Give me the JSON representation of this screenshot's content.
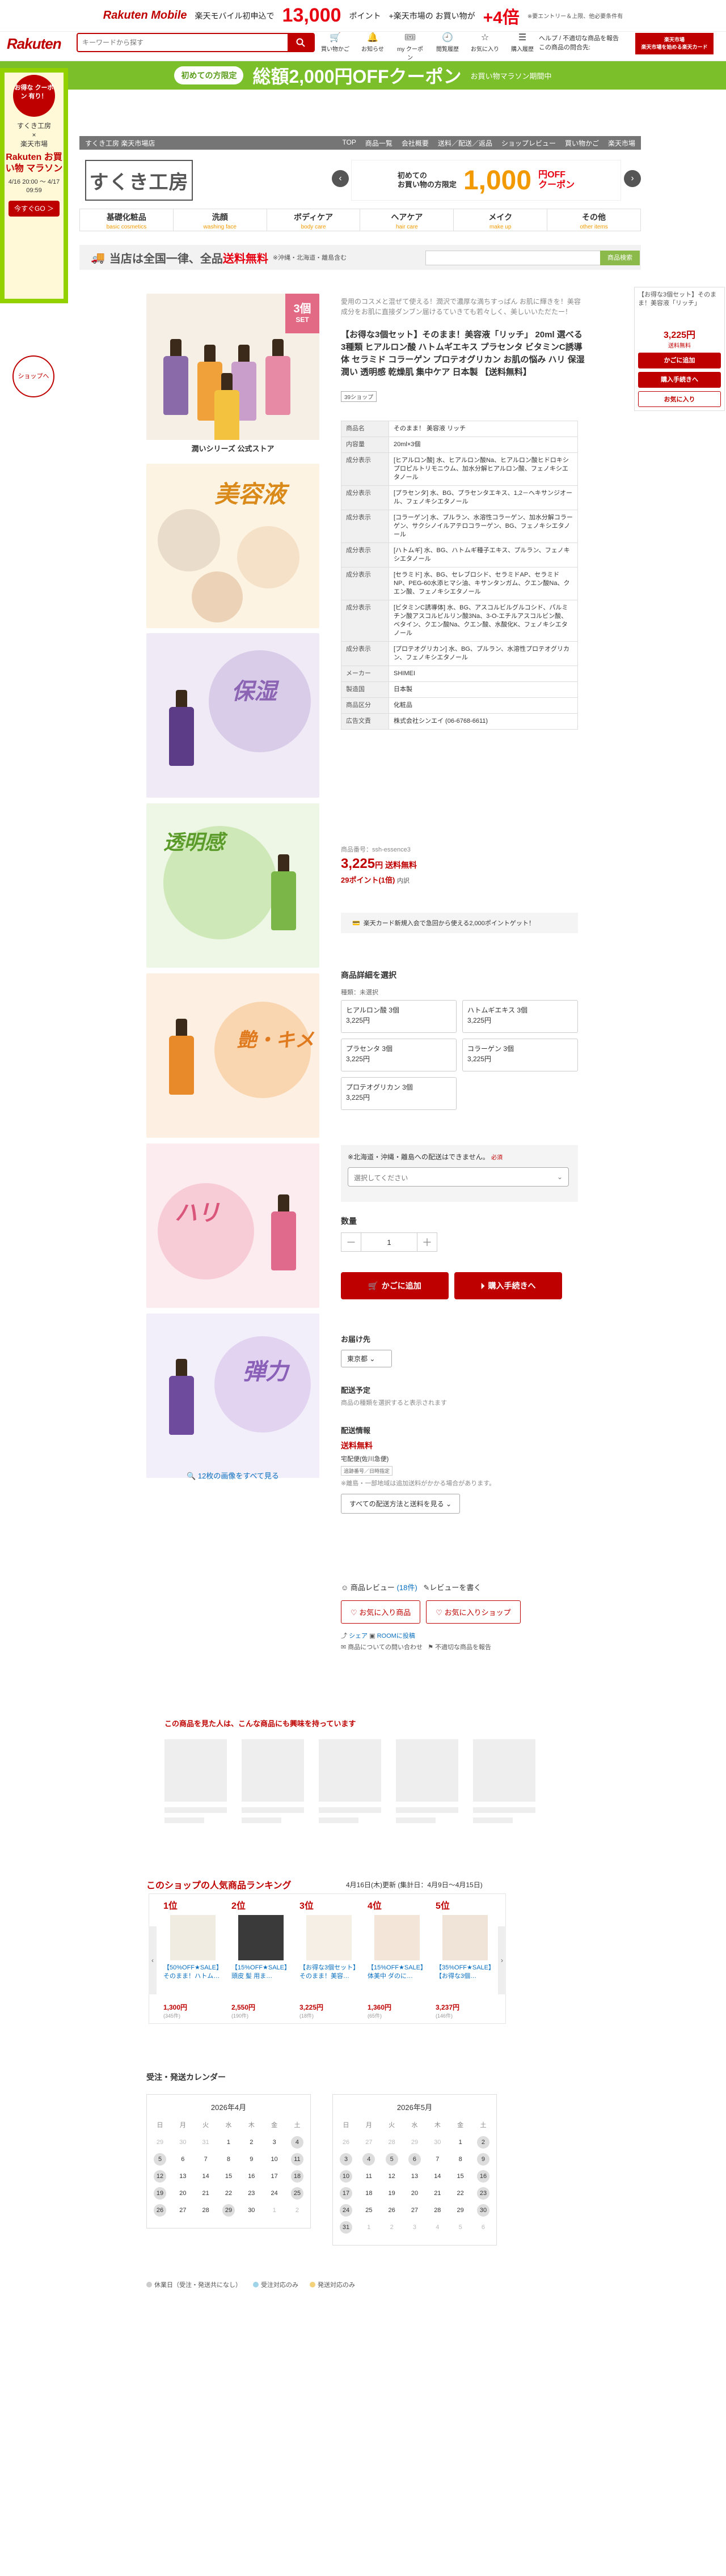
{
  "promo": {
    "brand": "Rakuten Mobile",
    "text1": "楽天モバイル初申込で",
    "big": "13,000",
    "pt": "ポイント",
    "plus_text": "+楽天市場の お買い物が",
    "plus": "+4倍",
    "note": "※要エントリー＆上限、他必要条件有"
  },
  "header": {
    "logo": "Rakuten",
    "search_placeholder": "キーワードから探す",
    "icons": [
      {
        "label": "買い物かご",
        "icon": "cart-icon",
        "glyph": "🛒"
      },
      {
        "label": "お知らせ",
        "icon": "bell-icon",
        "glyph": "🔔"
      },
      {
        "label": "my クーポン",
        "icon": "coupon-icon",
        "glyph": "🎟"
      },
      {
        "label": "閲覧履歴",
        "icon": "history-icon",
        "glyph": "🕘"
      },
      {
        "label": "お気に入り",
        "icon": "star-icon",
        "glyph": "☆"
      },
      {
        "label": "購入履歴",
        "icon": "list-icon",
        "glyph": "☰"
      }
    ],
    "help1": "ヘルプ / 不適切な商品を報告",
    "help2": "この商品の問合先:",
    "ad_line1": "楽天市場",
    "ad_line2": "楽天市場を始める楽天カード"
  },
  "green_banner": {
    "pill": "初めての方限定",
    "big": "総額2,000円OFFクーポン",
    "small": "お買い物マラソン期間中"
  },
  "side_campaign": {
    "coupon": "お得な クーポン 有り！",
    "t1": "すくき工房",
    "t2": "×",
    "t3": "楽天市場",
    "title": "Rakuten お買い物 マラソン",
    "dates": "4/16 20:00 ～ 4/17 09:59",
    "button": "今すぐGO ＞"
  },
  "float_shop": "ショップへ",
  "shopnav": {
    "name": "すくき工房 楽天市場店",
    "links": [
      "TOP",
      "商品一覧",
      "会社概要",
      "送料／配送／返品",
      "ショップレビュー",
      "買い物かご",
      "楽天市場"
    ]
  },
  "shop_logo": "すくき工房",
  "coupon_banner": {
    "line1": "初めての",
    "line2": "お買い物の方限定",
    "amount": "1,000",
    "unit": "円OFF",
    "unit2": "クーポン"
  },
  "categories": [
    {
      "ja": "基礎化粧品",
      "en": "basic cosmetics"
    },
    {
      "ja": "洗顔",
      "en": "washing face"
    },
    {
      "ja": "ボディケア",
      "en": "body care"
    },
    {
      "ja": "ヘアケア",
      "en": "hair care"
    },
    {
      "ja": "メイク",
      "en": "make up"
    },
    {
      "ja": "その他",
      "en": "other items"
    }
  ],
  "ship": {
    "pre": "当店は全国一律、全品",
    "red": "送料無料",
    "note": "※沖縄・北海道・離島含む",
    "search_btn": "商品検索"
  },
  "images": {
    "main_badge": "3個",
    "main_badge2": "SET",
    "store_label": "潤いシリーズ 公式ストア",
    "img2": "美容液",
    "img3": "保湿",
    "img4": "透明感",
    "img5": "艶・キメ",
    "img6": "ハリ",
    "img7": "弾力",
    "more": "12枚の画像をすべて見る"
  },
  "description": "愛用のコスメと混ぜて使える！潤沢で濃厚な満ちすっぱん お肌に輝きを！美容成分をお肌に直接ダンブン届けるていきても若々しく、美しいいただたー！",
  "title": "【お得な3個セット】そのまま！美容液「リッチ」 20ml 選べる3種類 ヒアルロン酸 ハトムギエキス プラセンタ ビタミンC誘導体 セラミド コラーゲン プロテオグリカン お肌の悩み ハリ 保湿 潤い 透明感 乾燥肌 集中ケア 日本製 【送料無料】",
  "shop_tag": "39ショップ",
  "spec": [
    {
      "k": "商品名",
      "v": "そのまま！ 美容液 リッチ"
    },
    {
      "k": "内容量",
      "v": "20ml×3個"
    },
    {
      "k": "成分表示",
      "v": "[ヒアルロン酸] 水、ヒアルロン酸Na、ヒアルロン酸ヒドロキシプロピルトリモニウム、加水分解ヒアルロン酸、フェノキシエタノール"
    },
    {
      "k": "成分表示",
      "v": "[プラセンタ] 水、BG、プラセンタエキス、1,2－ヘキサンジオール、フェノキシエタノール"
    },
    {
      "k": "成分表示",
      "v": "[コラーゲン] 水、プルラン、水溶性コラーゲン、加水分解コラーゲン、サクシノイルアテロコラーゲン、BG、フェノキシエタノール"
    },
    {
      "k": "成分表示",
      "v": "[ハトムギ] 水、BG、ハトムギ種子エキス、プルラン、フェノキシエタノール"
    },
    {
      "k": "成分表示",
      "v": "[セラミド] 水、BG、セレブロシド、セラミドAP、セラミドNP、PEG-60水添ヒマシ油、キサンタンガム、クエン酸Na、クエン酸、フェノキシエタノール"
    },
    {
      "k": "成分表示",
      "v": "[ビタミンC誘導体] 水、BG、アスコルビルグルコシド、パルミチン酸アスコルビルリン酸3Na、3-O-エチルアスコルビン酸、ベタイン、クエン酸Na、クエン酸、水酸化K、フェノキシエタノール"
    },
    {
      "k": "成分表示",
      "v": "[プロテオグリカン] 水、BG、プルラン、水溶性プロテオグリカン、フェノキシエタノール"
    },
    {
      "k": "メーカー",
      "v": "SHIMEI"
    },
    {
      "k": "製造国",
      "v": "日本製"
    },
    {
      "k": "商品区分",
      "v": "化粧品"
    },
    {
      "k": "広告文責",
      "v": "株式会社シンエイ (06-6768-6611)"
    }
  ],
  "price": {
    "num_label": "商品番号：",
    "num": "ssh-essence3",
    "amount": "3,225",
    "yen": "円",
    "free": "送料無料",
    "points": "29ポイント(1倍)",
    "points_note": "内訳"
  },
  "card_bar": "楽天カード新規入会で急回から使える2,000ポイントゲット！",
  "variation": {
    "title": "商品詳細を選択",
    "type_label": "種類：未選択",
    "options": [
      {
        "name": "ヒアルロン酸 3個",
        "price": "3,225円"
      },
      {
        "name": "ハトムギエキス 3個",
        "price": "3,225円"
      },
      {
        "name": "プラセンタ 3個",
        "price": "3,225円"
      },
      {
        "name": "コラーゲン 3個",
        "price": "3,225円"
      },
      {
        "name": "プロテオグリカン 3個",
        "price": "3,225円"
      }
    ]
  },
  "island": {
    "question": "※北海道・沖縄・離島への配送はできません。",
    "required": "必須",
    "select": "選択してください"
  },
  "qty": {
    "label": "数量",
    "value": "1",
    "minus": "－",
    "plus": "＋"
  },
  "cta": {
    "cart": "かごに追加",
    "buy": "購入手続きへ"
  },
  "delivery": {
    "dest_label": "お届け先",
    "dest": "東京都",
    "plan_label": "配送予定",
    "plan_text": "商品の種類を選択すると表示されます",
    "info_label": "配送情報",
    "free": "送料無料",
    "method": "宅配便(佐川急便)",
    "tag": "追跡番号／日時指定",
    "note": "※離島・一部地域は追加送料がかかる場合があります。",
    "btn": "すべての配送方法と送料を見る"
  },
  "review": {
    "label": "商品レビュー",
    "count": "(18件)",
    "write": "レビューを書く",
    "fav_item": "お気に入り商品",
    "fav_shop": "お気に入りショップ",
    "share": "シェア",
    "room": "ROOMに投稿",
    "ask": "商品についての問い合わせ",
    "report": "不適切な商品を報告"
  },
  "mini": {
    "title": "【お得な3個セット】そのまま！美容液「リッチ」",
    "price": "3,225円",
    "free": "送料無料",
    "cart": "かごに追加",
    "buy": "購入手続きへ",
    "fav": "お気に入り"
  },
  "recommend_title": "この商品を見た人は、こんな商品にも興味を持っています",
  "ranking": {
    "title": "このショップの人気商品ランキング",
    "date": "4月16日(木)更新 (集計日：4月9日～4月15日)",
    "items": [
      {
        "rank": "1位",
        "name": "【50%OFF★SALE】 そのまま！ハトム…",
        "price": "1,300円",
        "reviews": "(345件)"
      },
      {
        "rank": "2位",
        "name": "【15%OFF★SALE】 頭皮 髪 用ま…",
        "price": "2,550円",
        "reviews": "(190件)"
      },
      {
        "rank": "3位",
        "name": "【お得な3個セット】そのまま！美容…",
        "price": "3,225円",
        "reviews": "(18件)"
      },
      {
        "rank": "4位",
        "name": "【15%OFF★SALE】 体美中 ダのに…",
        "price": "1,360円",
        "reviews": "(65件)"
      },
      {
        "rank": "5位",
        "name": "【35%OFF★SALE】 【お得な3個…",
        "price": "3,237円",
        "reviews": "(146件)"
      }
    ]
  },
  "calendar": {
    "title": "受注・発送カレンダー",
    "headers": [
      "日",
      "月",
      "火",
      "水",
      "木",
      "金",
      "土"
    ],
    "months": [
      {
        "cap": "2026年4月",
        "rows": [
          [
            "29",
            "30",
            "31",
            "1",
            "2",
            "3",
            "4"
          ],
          [
            "5",
            "6",
            "7",
            "8",
            "9",
            "10",
            "11"
          ],
          [
            "12",
            "13",
            "14",
            "15",
            "16",
            "17",
            "18"
          ],
          [
            "19",
            "20",
            "21",
            "22",
            "23",
            "24",
            "25"
          ],
          [
            "26",
            "27",
            "28",
            "29",
            "30",
            "1",
            "2"
          ]
        ]
      },
      {
        "cap": "2026年5月",
        "rows": [
          [
            "26",
            "27",
            "28",
            "29",
            "30",
            "1",
            "2"
          ],
          [
            "3",
            "4",
            "5",
            "6",
            "7",
            "8",
            "9"
          ],
          [
            "10",
            "11",
            "12",
            "13",
            "14",
            "15",
            "16"
          ],
          [
            "17",
            "18",
            "19",
            "20",
            "21",
            "22",
            "23"
          ],
          [
            "24",
            "25",
            "26",
            "27",
            "28",
            "29",
            "30"
          ],
          [
            "31",
            "1",
            "2",
            "3",
            "4",
            "5",
            "6"
          ]
        ]
      }
    ],
    "legend": [
      "休業日（受注・発送共になし）",
      "受注対応のみ",
      "発送対応のみ"
    ],
    "legend_colors": [
      "#cccccc",
      "#9fd3e8",
      "#f3d27a"
    ]
  }
}
